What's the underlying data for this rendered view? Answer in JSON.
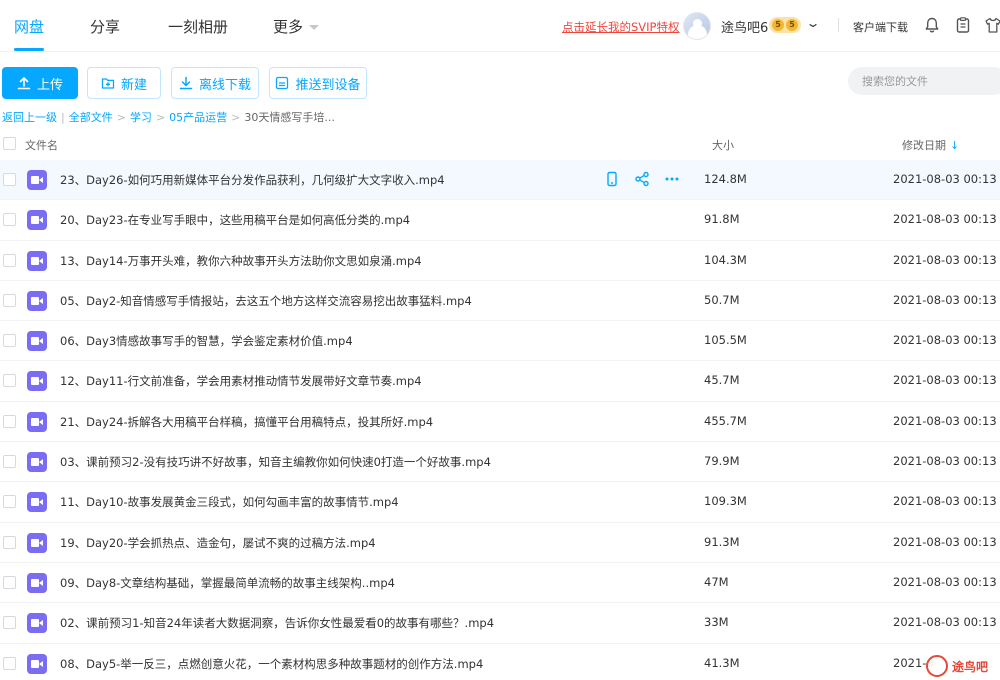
{
  "nav": {
    "tabs": [
      {
        "label": "网盘",
        "active": true
      },
      {
        "label": "分享",
        "active": false
      },
      {
        "label": "一刻相册",
        "active": false
      },
      {
        "label": "更多",
        "active": false
      }
    ],
    "svip_link": "点击延长我的SVIP特权",
    "username": "途鸟吧6",
    "vip_badge": "5",
    "client_download": "客户端下载",
    "icons": [
      "bell-icon",
      "clipboard-icon",
      "shirt-icon"
    ]
  },
  "toolbar": {
    "upload_label": "上传",
    "new_label": "新建",
    "offline_download_label": "离线下载",
    "push_device_label": "推送到设备",
    "search_placeholder": "搜索您的文件"
  },
  "breadcrumb": {
    "back": "返回上一级",
    "items": [
      "全部文件",
      "学习",
      "05产品运营"
    ],
    "current": "30天情感写手培..."
  },
  "table": {
    "headers": {
      "name": "文件名",
      "size": "大小",
      "date": "修改日期"
    },
    "sort_indicator": "↓",
    "rows": [
      {
        "name": "23、Day26-如何巧用新媒体平台分发作品获利，几何级扩大文字收入.mp4",
        "size": "124.8M",
        "date": "2021-08-03 00:13"
      },
      {
        "name": "20、Day23-在专业写手眼中，这些用稿平台是如何高低分类的.mp4",
        "size": "91.8M",
        "date": "2021-08-03 00:13"
      },
      {
        "name": "13、Day14-万事开头难，教你六种故事开头方法助你文思如泉涌.mp4",
        "size": "104.3M",
        "date": "2021-08-03 00:13"
      },
      {
        "name": "05、Day2-知音情感写手情报站，去这五个地方这样交流容易挖出故事猛料.mp4",
        "size": "50.7M",
        "date": "2021-08-03 00:13"
      },
      {
        "name": "06、Day3情感故事写手的智慧，学会鉴定素材价值.mp4",
        "size": "105.5M",
        "date": "2021-08-03 00:13"
      },
      {
        "name": "12、Day11-行文前准备，学会用素材推动情节发展带好文章节奏.mp4",
        "size": "45.7M",
        "date": "2021-08-03 00:13"
      },
      {
        "name": "21、Day24-拆解各大用稿平台样稿，搞懂平台用稿特点，投其所好.mp4",
        "size": "455.7M",
        "date": "2021-08-03 00:13"
      },
      {
        "name": "03、课前预习2-没有技巧讲不好故事，知音主编教你如何快速0打造一个好故事.mp4",
        "size": "79.9M",
        "date": "2021-08-03 00:13"
      },
      {
        "name": "11、Day10-故事发展黄金三段式，如何勾画丰富的故事情节.mp4",
        "size": "109.3M",
        "date": "2021-08-03 00:13"
      },
      {
        "name": "19、Day20-学会抓热点、造金句，屡试不爽的过稿方法.mp4",
        "size": "91.3M",
        "date": "2021-08-03 00:13"
      },
      {
        "name": "09、Day8-文章结构基础，掌握最简单流畅的故事主线架构..mp4",
        "size": "47M",
        "date": "2021-08-03 00:13"
      },
      {
        "name": "02、课前预习1-知音24年读者大数据洞察，告诉你女性最爱看0的故事有哪些？.mp4",
        "size": "33M",
        "date": "2021-08-03 00:13"
      },
      {
        "name": "08、Day5-举一反三，点燃创意火花，一个素材构思多种故事题材的创作方法.mp4",
        "size": "41.3M",
        "date": "2021-0"
      }
    ]
  },
  "watermark": "途鸟吧",
  "colors": {
    "accent": "#06a7ff",
    "svip": "#f0453b",
    "video_icon": "#7b6df3"
  }
}
